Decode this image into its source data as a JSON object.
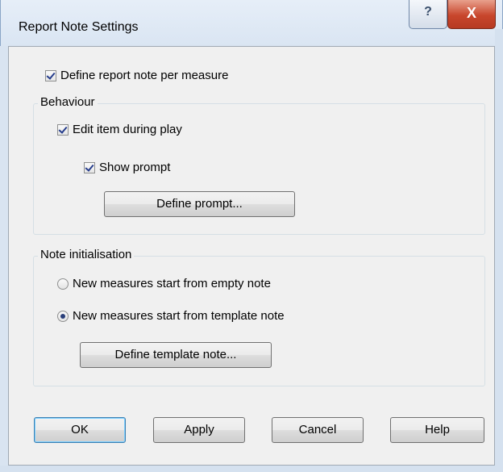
{
  "window": {
    "title": "Report Note Settings",
    "help_glyph": "?",
    "close_glyph": "X"
  },
  "define_per_measure": {
    "label": "Define report note per measure",
    "checked": true
  },
  "behaviour": {
    "label": "Behaviour",
    "edit_during_play": {
      "label": "Edit item during play",
      "checked": true
    },
    "show_prompt": {
      "label": "Show prompt",
      "checked": true
    },
    "define_prompt_label": "Define prompt..."
  },
  "note_init": {
    "label": "Note initialisation",
    "empty_note": {
      "label": "New measures start from empty note",
      "selected": false
    },
    "template_note": {
      "label": "New measures start from template note",
      "selected": true
    },
    "define_template_label": "Define template note..."
  },
  "buttons": {
    "ok": "OK",
    "apply": "Apply",
    "cancel": "Cancel",
    "help": "Help"
  }
}
